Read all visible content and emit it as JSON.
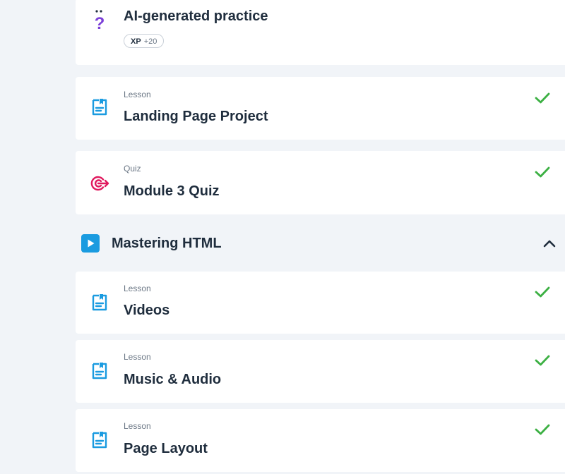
{
  "practice": {
    "title": "AI-generated practice",
    "xp_label": "XP",
    "xp_value": "+20",
    "icon": "ai-question-icon"
  },
  "items_top": [
    {
      "type": "Lesson",
      "title": "Landing Page Project",
      "icon": "lesson-doc-icon",
      "completed": true
    },
    {
      "type": "Quiz",
      "title": "Module 3 Quiz",
      "icon": "quiz-target-icon",
      "completed": true
    }
  ],
  "section": {
    "title": "Mastering HTML",
    "icon": "video-play-icon",
    "expanded": true
  },
  "items_section": [
    {
      "type": "Lesson",
      "title": "Videos",
      "icon": "lesson-doc-icon",
      "completed": true
    },
    {
      "type": "Lesson",
      "title": "Music & Audio",
      "icon": "lesson-doc-icon",
      "completed": true
    },
    {
      "type": "Lesson",
      "title": "Page Layout",
      "icon": "lesson-doc-icon",
      "completed": true
    }
  ],
  "colors": {
    "background": "#f1f4f8",
    "check": "#3cb043",
    "lesson_icon": "#1a9be0",
    "quiz_icon": "#e0195e",
    "practice_icon": "#7b3fd8",
    "section_icon": "#1a9be0"
  }
}
